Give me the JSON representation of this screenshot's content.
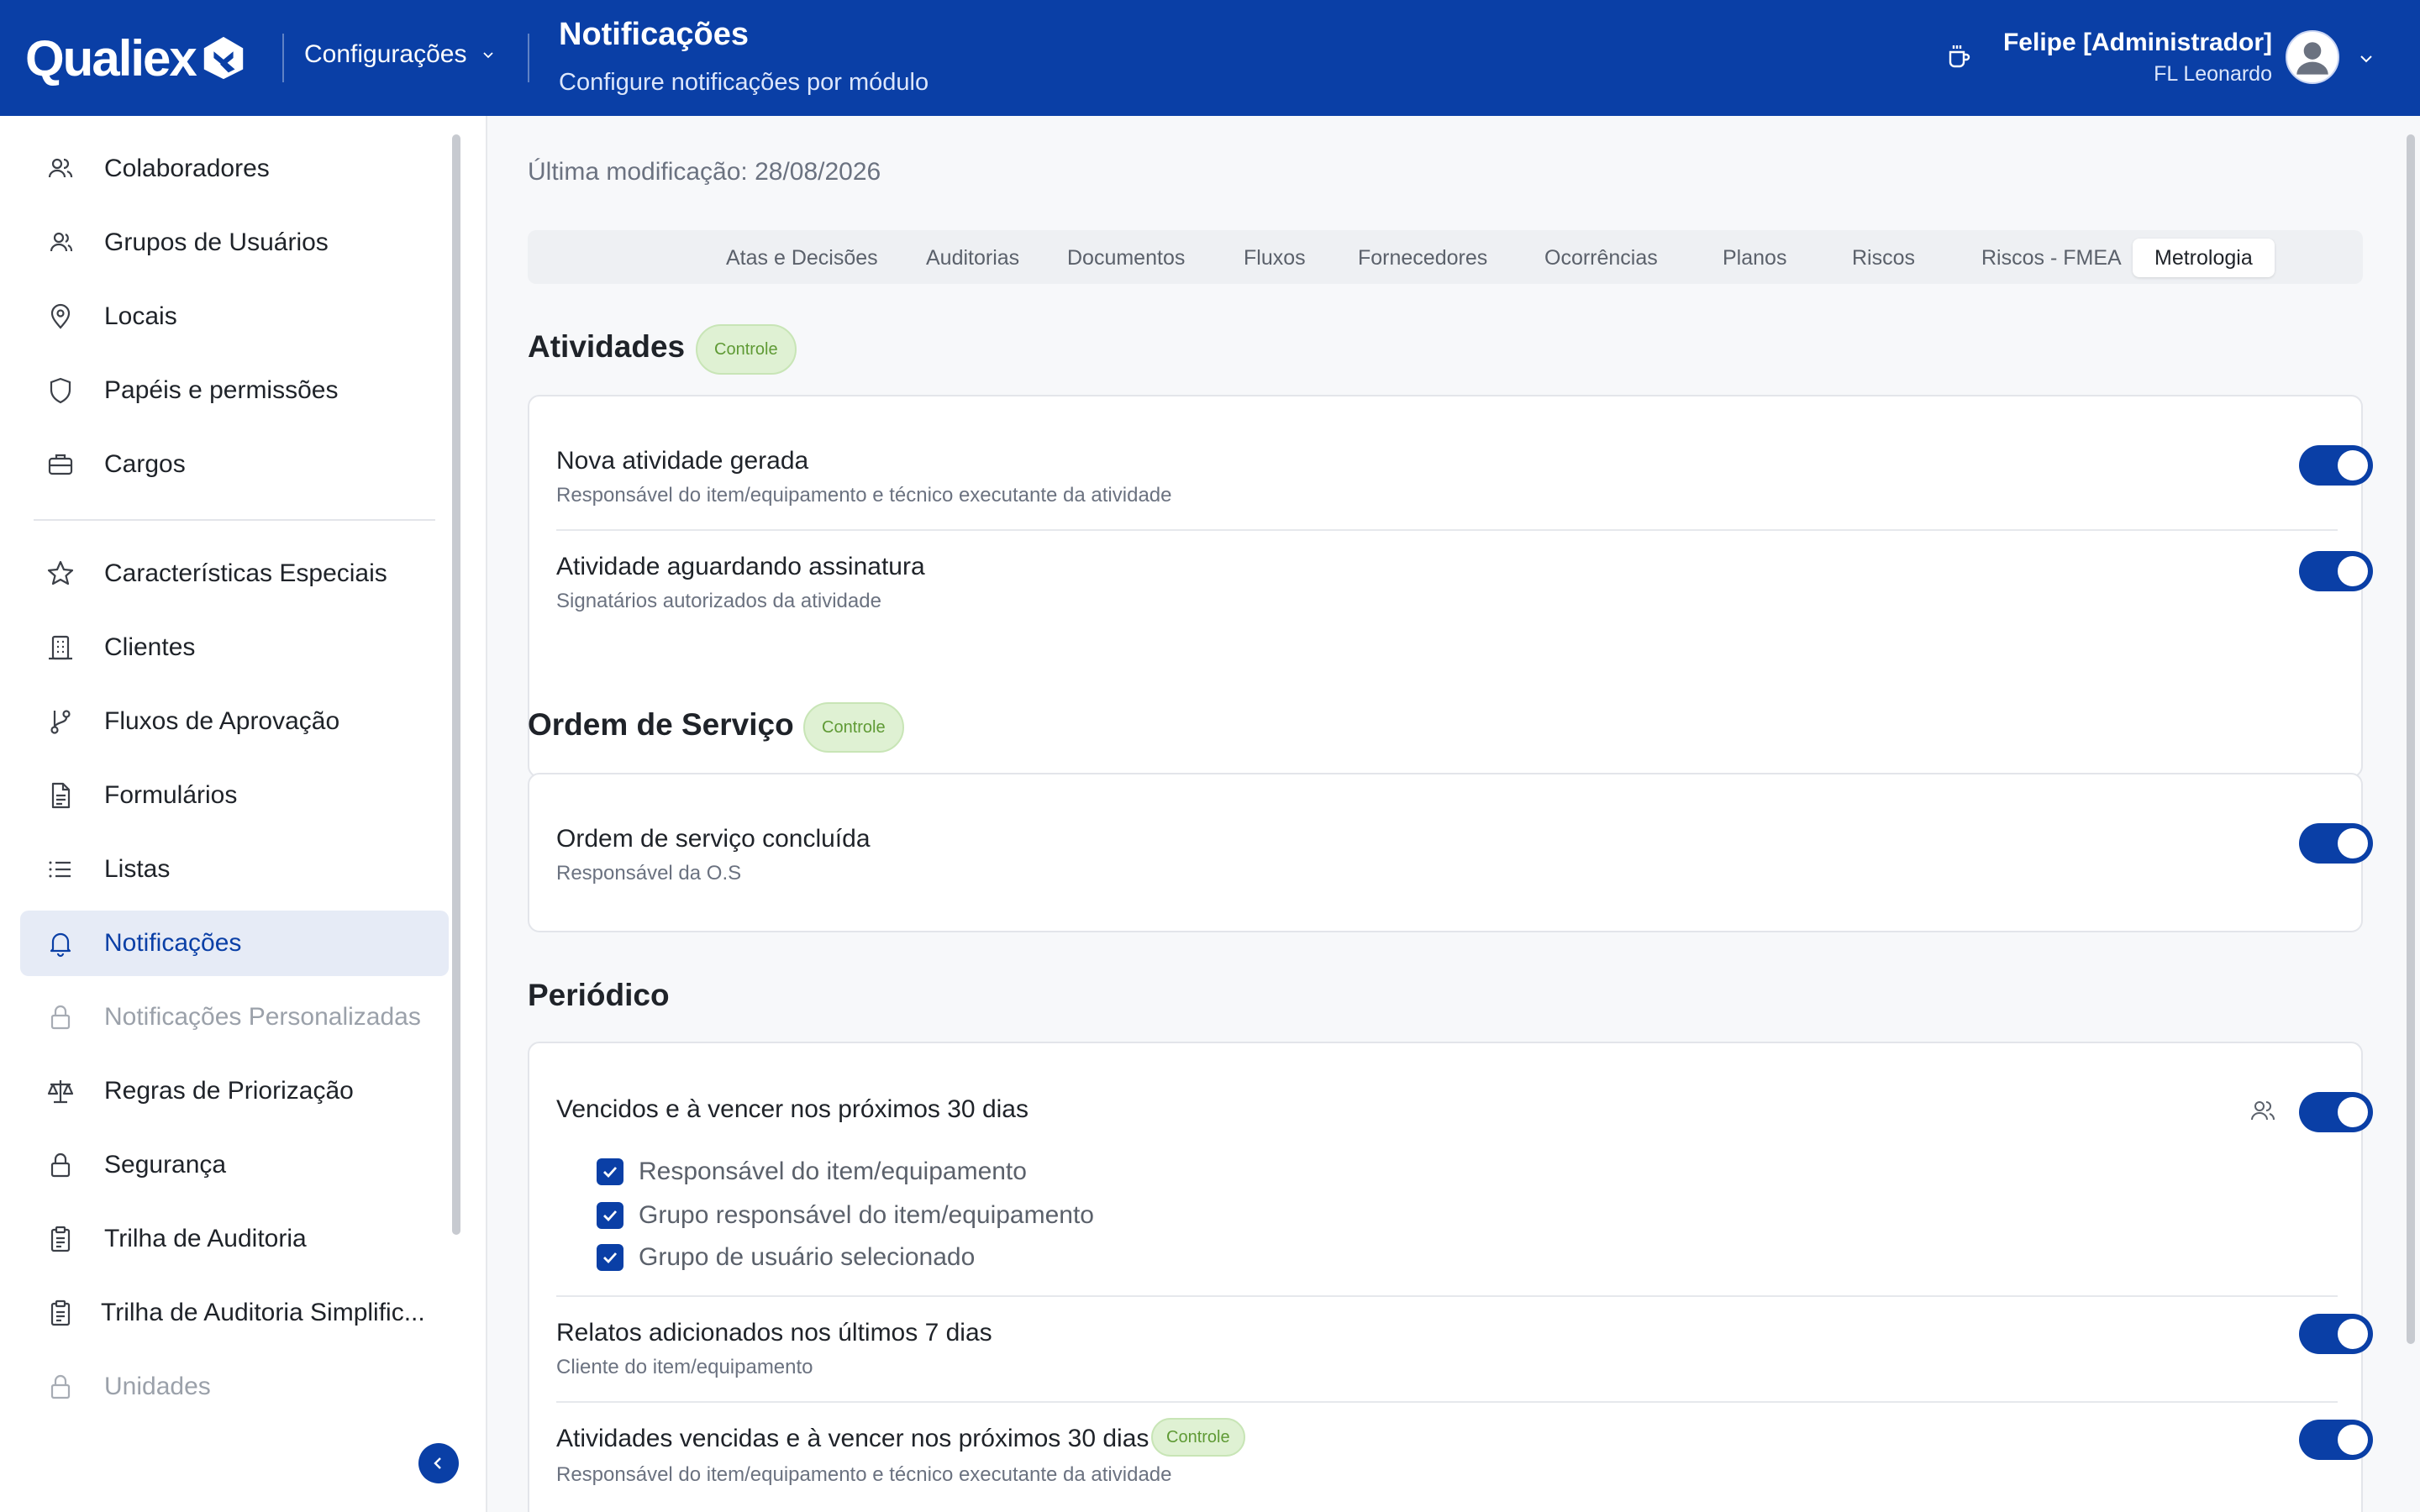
{
  "header": {
    "logo_text": "Qualiex",
    "module": "Configurações",
    "title": "Notificações",
    "subtitle": "Configure notificações por módulo",
    "user_name": "Felipe [Administrador]",
    "user_org": "FL Leonardo",
    "colors": {
      "primary": "#0a3fa6"
    }
  },
  "sidebar": {
    "items": [
      {
        "label": "Colaboradores",
        "icon": "users-icon"
      },
      {
        "label": "Grupos de Usuários",
        "icon": "user-group-icon"
      },
      {
        "label": "Locais",
        "icon": "map-pin-icon"
      },
      {
        "label": "Papéis e permissões",
        "icon": "shield-icon"
      },
      {
        "label": "Cargos",
        "icon": "briefcase-icon"
      },
      {
        "label": "Características Especiais",
        "icon": "star-icon"
      },
      {
        "label": "Clientes",
        "icon": "building-icon"
      },
      {
        "label": "Fluxos de Aprovação",
        "icon": "git-branch-icon"
      },
      {
        "label": "Formulários",
        "icon": "file-text-icon"
      },
      {
        "label": "Listas",
        "icon": "list-icon"
      },
      {
        "label": "Notificações",
        "icon": "bell-icon",
        "active": true
      },
      {
        "label": "Notificações Personalizadas",
        "icon": "lock-icon",
        "disabled": true
      },
      {
        "label": "Regras de Priorização",
        "icon": "scale-icon"
      },
      {
        "label": "Segurança",
        "icon": "lock-icon"
      },
      {
        "label": "Trilha de Auditoria",
        "icon": "clipboard-icon"
      },
      {
        "label": "Trilha de Auditoria Simplific...",
        "icon": "clipboard-icon"
      },
      {
        "label": "Unidades",
        "icon": "lock-icon",
        "disabled": true
      }
    ]
  },
  "main": {
    "last_modified": "Última modificação: 28/08/2026",
    "tabs": [
      {
        "label": "Atas e Decisões"
      },
      {
        "label": "Auditorias"
      },
      {
        "label": "Documentos"
      },
      {
        "label": "Fluxos"
      },
      {
        "label": "Fornecedores"
      },
      {
        "label": "Ocorrências"
      },
      {
        "label": "Planos"
      },
      {
        "label": "Riscos"
      },
      {
        "label": "Riscos - FMEA"
      },
      {
        "label": "Metrologia",
        "active": true
      }
    ],
    "sections": [
      {
        "title": "Atividades",
        "badge": "Controle",
        "rows": [
          {
            "title": "Nova atividade gerada",
            "desc": "Responsável do item/equipamento e técnico executante da atividade",
            "enabled": true
          },
          {
            "title": "Atividade aguardando assinatura",
            "desc": "Signatários autorizados da atividade",
            "enabled": true
          }
        ]
      },
      {
        "title": "Ordem de Serviço",
        "badge": "Controle",
        "rows": [
          {
            "title": "Ordem de serviço concluída",
            "desc": "Responsável da O.S",
            "enabled": true
          }
        ]
      },
      {
        "title": "Periódico",
        "rows": [
          {
            "title": "Vencidos e à vencer nos próximos 30 dias",
            "enabled": true,
            "options": [
              {
                "label": "Responsável do item/equipamento",
                "checked": true
              },
              {
                "label": "Grupo responsável do item/equipamento",
                "checked": true
              },
              {
                "label": "Grupo de usuário selecionado",
                "checked": true
              }
            ]
          },
          {
            "title": "Relatos adicionados nos últimos 7 dias",
            "desc": "Cliente do item/equipamento",
            "enabled": true
          },
          {
            "title": "Atividades vencidas e à vencer nos próximos 30 dias",
            "badge": "Controle",
            "desc": "Responsável do item/equipamento e técnico executante da atividade",
            "enabled": true
          }
        ]
      }
    ]
  }
}
